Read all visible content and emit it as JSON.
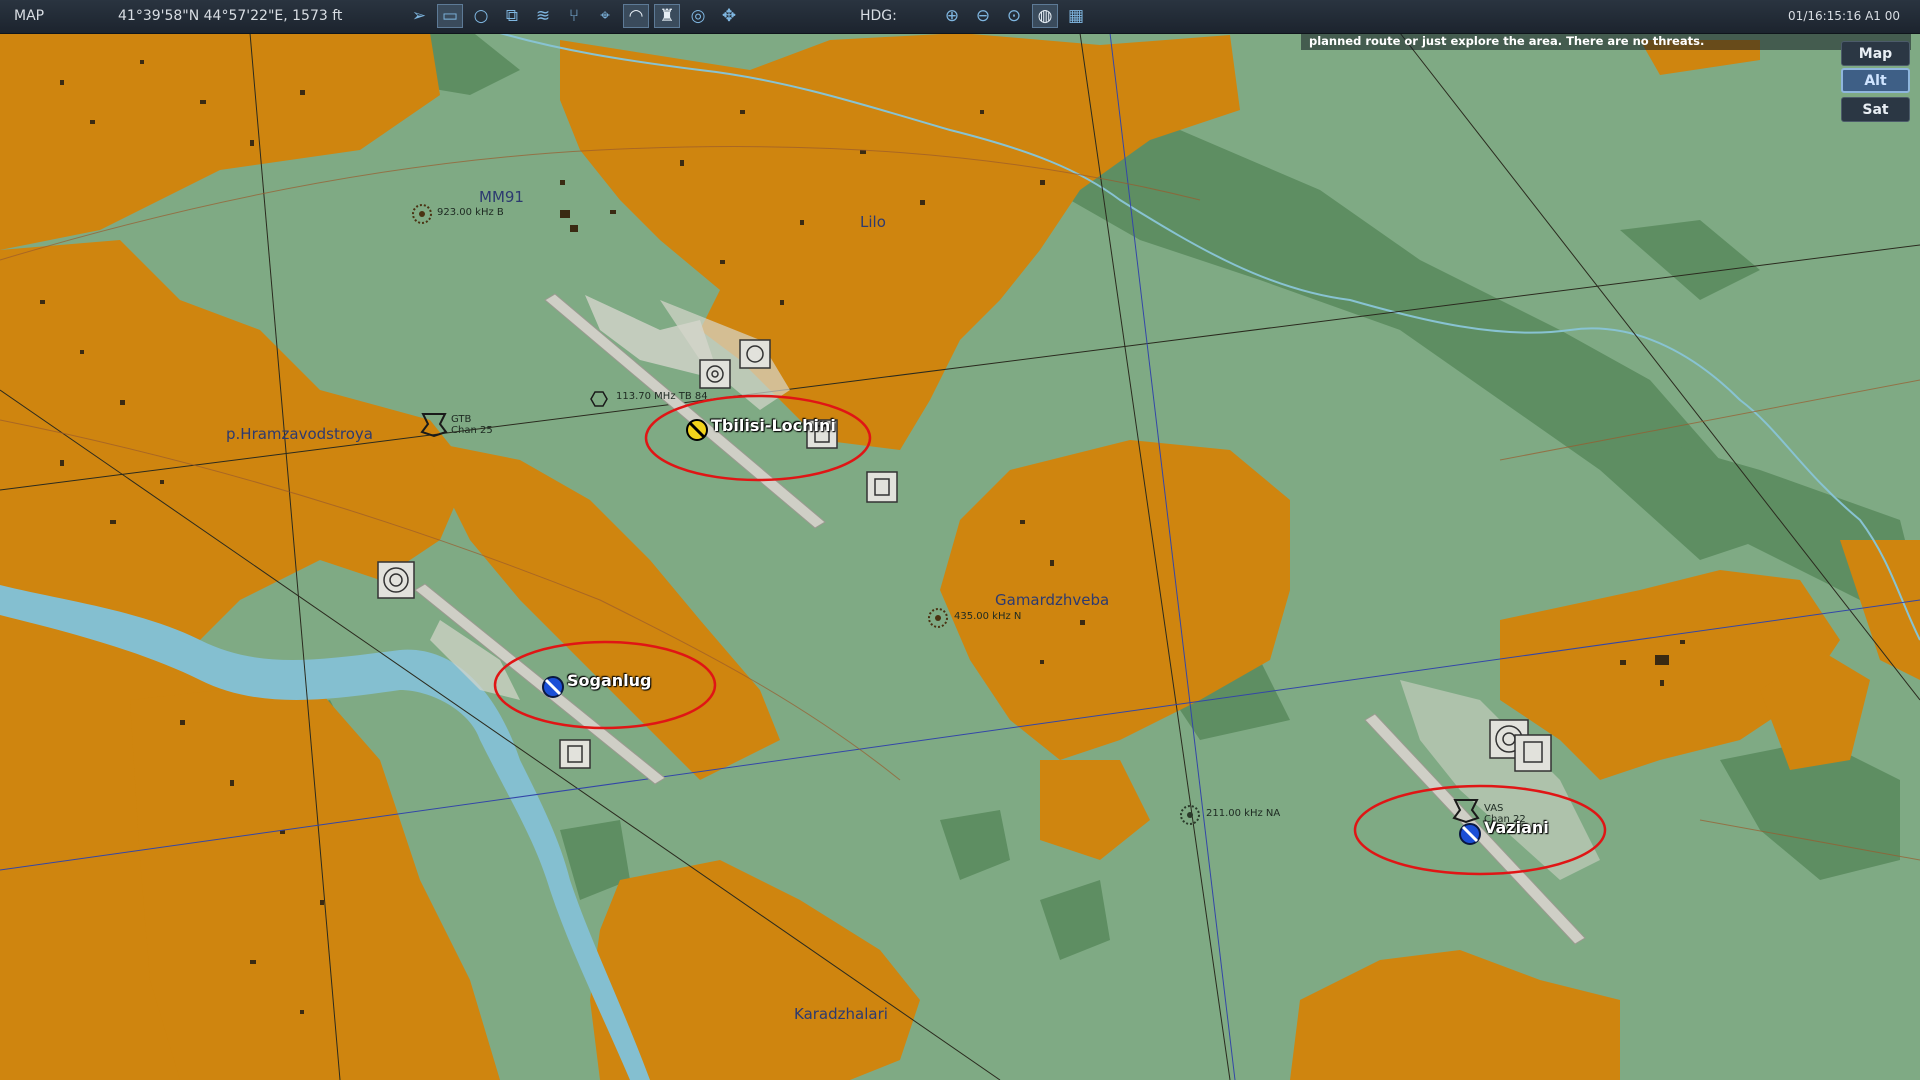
{
  "toolbar": {
    "mode_label": "MAP",
    "coordinates": "41°39'58\"N 44°57'22\"E, 1573 ft",
    "heading_label": "HDG:",
    "clock": "01/16:15:16 A1 00",
    "tools": [
      {
        "name": "cursor-arrow-icon",
        "glyph": "➢"
      },
      {
        "name": "aircraft-filter-icon",
        "glyph": "▭"
      },
      {
        "name": "circle-draw-icon",
        "glyph": "○"
      },
      {
        "name": "layers-icon",
        "glyph": "⧉"
      },
      {
        "name": "terrain-icon",
        "glyph": "≋"
      },
      {
        "name": "route-icon",
        "glyph": "⑂"
      },
      {
        "name": "target-crosshair-icon",
        "glyph": "⌖"
      },
      {
        "name": "wifi-signal-icon",
        "glyph": "◠"
      },
      {
        "name": "tower-icon",
        "glyph": "♜"
      },
      {
        "name": "chat-bubble-icon",
        "glyph": "◎"
      },
      {
        "name": "move-arrows-icon",
        "glyph": "✥"
      }
    ],
    "view_tools": [
      {
        "name": "zoom-in-icon",
        "glyph": "⊕"
      },
      {
        "name": "zoom-out-icon",
        "glyph": "⊖"
      },
      {
        "name": "zoom-fit-icon",
        "glyph": "⊙"
      },
      {
        "name": "globe-icon",
        "glyph": "◍"
      },
      {
        "name": "grid-icon",
        "glyph": "▦"
      }
    ]
  },
  "briefing": {
    "text": "This mission starts with a cold and dark aircraft parked on the ramp.  You may fly the planned route or just explore the area.  There are no threats."
  },
  "map_types": {
    "map": "Map",
    "alt": "Alt",
    "sat": "Sat",
    "selected": "Alt"
  },
  "labels": {
    "mm91": "MM91",
    "ndb_923": "923.00 kHz B",
    "lilo": "Lilo",
    "vor_113": "113.70 MHz TB 84",
    "gtb": "GTB",
    "gtb_chan": "Chan 25",
    "hramzavodstroya": "p.Hramzavodstroya",
    "tbilisi": "Tbilisi-Lochini",
    "ndb_435": "435.00 kHz N",
    "gamardzhveba": "Gamardzhveba",
    "soganlug": "Soganlug",
    "ndb_211": "211.00 kHz NA",
    "vas": "VAS",
    "vas_chan": "Chan 22",
    "vaziani": "Vaziani",
    "karadzhalari": "Karadzhalari"
  },
  "colors": {
    "terrain_green": "#7faa84",
    "forest": "#5e8e62",
    "urban": "#cf850f",
    "river": "#84bfd0",
    "highlight_circle": "#e01515",
    "airport_blue": "#1b4fd6",
    "airport_yellow": "#f2d21b"
  }
}
